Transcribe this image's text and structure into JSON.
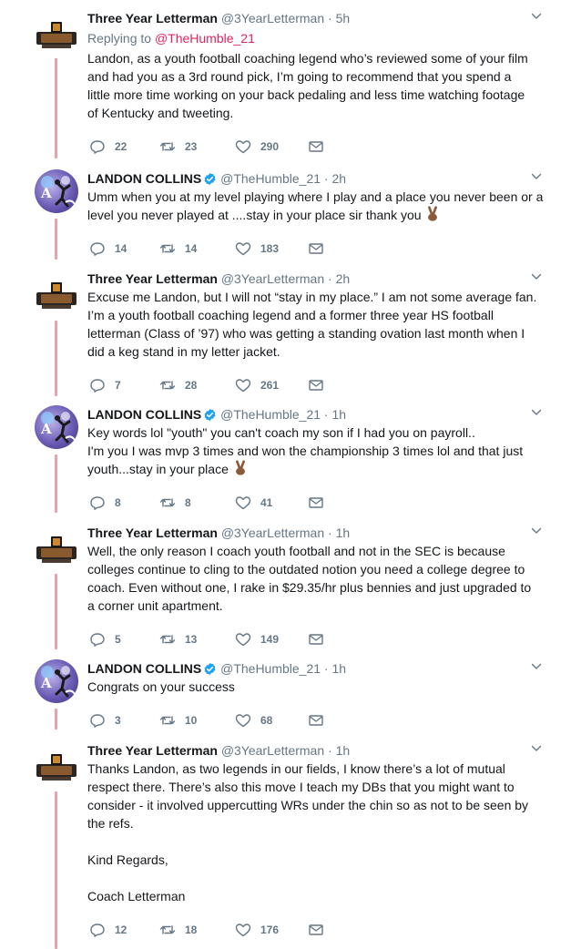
{
  "thread": {
    "tweets": [
      {
        "name": "Three Year Letterman",
        "handle": "@3YearLetterman",
        "time": "5h",
        "replying_prefix": "Replying to",
        "replying_to": "@TheHumble_21",
        "lines": [
          "Landon, as a youth football coaching legend who’s reviewed some of your film",
          "and had you as a 3rd round pick, I’m going to recommend that you spend a",
          "little more time working on your back pedaling and less time watching footage",
          "of Kentucky and tweeting."
        ],
        "replies": "22",
        "retweets": "23",
        "likes": "290"
      },
      {
        "name": "LANDON COLLINS",
        "handle": "@TheHumble_21",
        "time": "2h",
        "lines": [
          "Umm when you at my level playing where I play and a place you never been or a",
          "level you never played at ....stay in your place sir thank you"
        ],
        "emoji_line": 1,
        "replies": "14",
        "retweets": "14",
        "likes": "183"
      },
      {
        "name": "Three Year Letterman",
        "handle": "@3YearLetterman",
        "time": "2h",
        "lines": [
          "Excuse me Landon, but I will not “stay in my place.” I am not some average fan.",
          "I’m a youth football coaching legend and a former three year HS football",
          "letterman (Class of ’97) who was getting a standing ovation last month when I",
          "did a keg stand in my letter jacket."
        ],
        "replies": "7",
        "retweets": "28",
        "likes": "261"
      },
      {
        "name": "LANDON COLLINS",
        "handle": "@TheHumble_21",
        "time": "1h",
        "lines": [
          "Key words lol \"youth\" you can't coach my son if I had you on payroll..",
          "I'm you I was mvp 3 times and won the championship 3 times lol and that just",
          "youth...stay in your place"
        ],
        "emoji_line": 2,
        "replies": "8",
        "retweets": "8",
        "likes": "41"
      },
      {
        "name": "Three Year Letterman",
        "handle": "@3YearLetterman",
        "time": "1h",
        "lines": [
          "Well, the only reason I coach youth football and not in the SEC is because",
          "colleges continue to cling to the outdated notion you need a college degree to",
          "coach. Even without one, I rake in $29.35/hr plus bennies and just upgraded to",
          "a corner unit apartment."
        ],
        "replies": "5",
        "retweets": "13",
        "likes": "149"
      },
      {
        "name": "LANDON COLLINS",
        "handle": "@TheHumble_21",
        "time": "1h",
        "lines": [
          "Congrats on your success"
        ],
        "replies": "3",
        "retweets": "10",
        "likes": "68"
      },
      {
        "name": "Three Year Letterman",
        "handle": "@3YearLetterman",
        "time": "1h",
        "lines": [
          "Thanks Landon, as two legends in our fields, I know there’s a lot of mutual",
          "respect there. There’s also this move I teach my DBs that you might want to",
          "consider - it involved uppercutting WRs under the chin so as not to be seen by",
          "the refs.",
          "",
          "Kind Regards,",
          "",
          "Coach Letterman"
        ],
        "replies": "12",
        "retweets": "18",
        "likes": "176"
      }
    ]
  },
  "icons": {
    "reply": "reply-icon",
    "retweet": "retweet-icon",
    "like": "heart-icon",
    "dm": "envelope-icon",
    "more": "chevron-down-icon",
    "verified": "verified-badge-icon",
    "emoji": "victory-hand-emoji"
  },
  "colors": {
    "thread_line": "#e1a5ad",
    "mention": "#e0245e",
    "muted": "#657786",
    "verified": "#1da1f2"
  }
}
